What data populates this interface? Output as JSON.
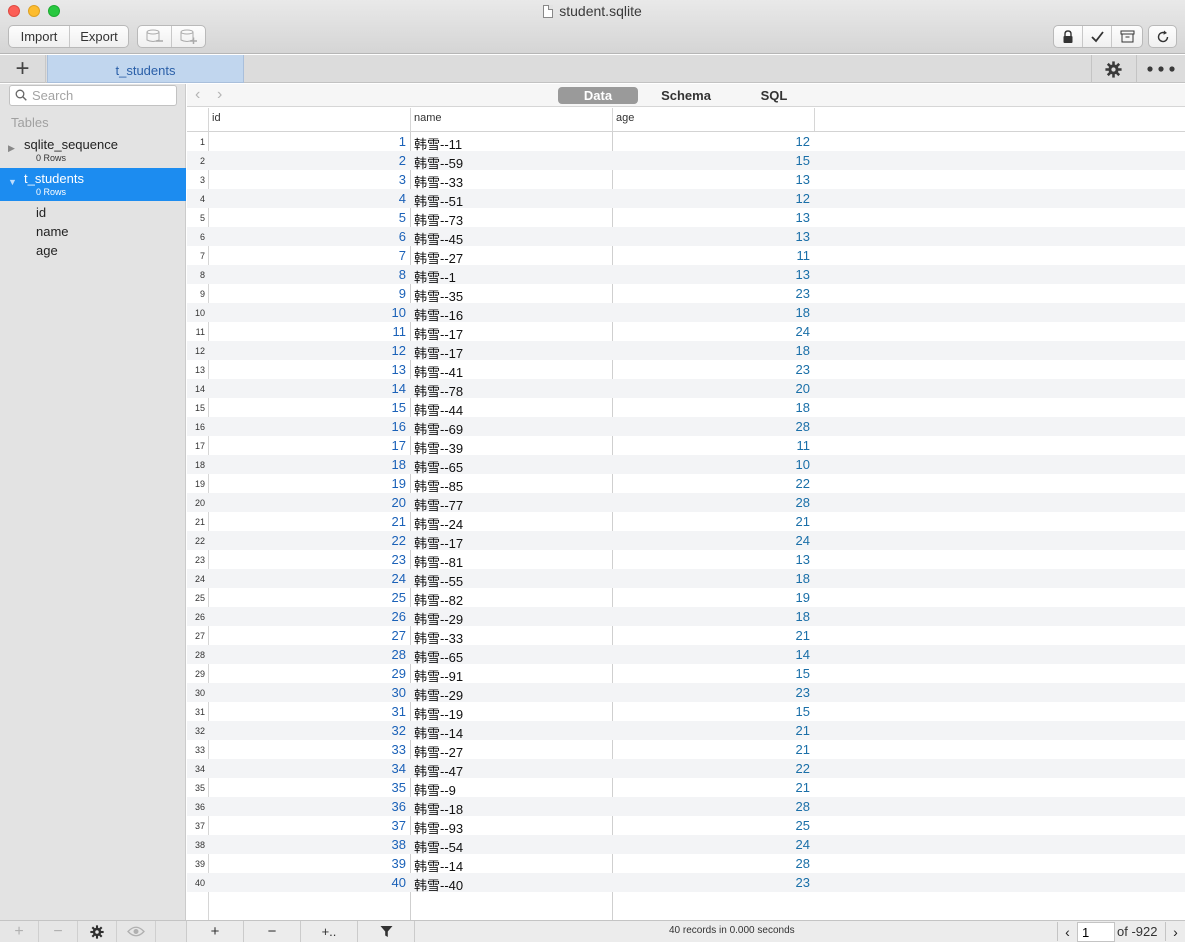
{
  "window": {
    "title": "student.sqlite"
  },
  "toolbar": {
    "import_label": "Import",
    "export_label": "Export",
    "db_remove_icon": "database-remove-icon",
    "db_add_icon": "database-add-icon",
    "lock_icon": "lock-icon",
    "check_icon": "checkmark-icon",
    "archive_icon": "archive-icon",
    "refresh_icon": "refresh-icon"
  },
  "tabs": {
    "add_label": "+",
    "active_tab": "t_students"
  },
  "sidebar": {
    "search_placeholder": "Search",
    "tables_header": "Tables",
    "tables": [
      {
        "name": "sqlite_sequence",
        "rows": "0 Rows",
        "expanded": false,
        "selected": false
      },
      {
        "name": "t_students",
        "rows": "0 Rows",
        "expanded": true,
        "selected": true
      }
    ],
    "columns": [
      "id",
      "name",
      "age"
    ]
  },
  "view_tabs": [
    "Data",
    "Schema",
    "SQL"
  ],
  "active_view": "Data",
  "grid": {
    "headers": [
      "id",
      "name",
      "age"
    ],
    "rows": [
      [
        1,
        "韩雪--11",
        12
      ],
      [
        2,
        "韩雪--59",
        15
      ],
      [
        3,
        "韩雪--33",
        13
      ],
      [
        4,
        "韩雪--51",
        12
      ],
      [
        5,
        "韩雪--73",
        13
      ],
      [
        6,
        "韩雪--45",
        13
      ],
      [
        7,
        "韩雪--27",
        11
      ],
      [
        8,
        "韩雪--1",
        13
      ],
      [
        9,
        "韩雪--35",
        23
      ],
      [
        10,
        "韩雪--16",
        18
      ],
      [
        11,
        "韩雪--17",
        24
      ],
      [
        12,
        "韩雪--17",
        18
      ],
      [
        13,
        "韩雪--41",
        23
      ],
      [
        14,
        "韩雪--78",
        20
      ],
      [
        15,
        "韩雪--44",
        18
      ],
      [
        16,
        "韩雪--69",
        28
      ],
      [
        17,
        "韩雪--39",
        11
      ],
      [
        18,
        "韩雪--65",
        10
      ],
      [
        19,
        "韩雪--85",
        22
      ],
      [
        20,
        "韩雪--77",
        28
      ],
      [
        21,
        "韩雪--24",
        21
      ],
      [
        22,
        "韩雪--17",
        24
      ],
      [
        23,
        "韩雪--81",
        13
      ],
      [
        24,
        "韩雪--55",
        18
      ],
      [
        25,
        "韩雪--82",
        19
      ],
      [
        26,
        "韩雪--29",
        18
      ],
      [
        27,
        "韩雪--33",
        21
      ],
      [
        28,
        "韩雪--65",
        14
      ],
      [
        29,
        "韩雪--91",
        15
      ],
      [
        30,
        "韩雪--29",
        23
      ],
      [
        31,
        "韩雪--19",
        15
      ],
      [
        32,
        "韩雪--14",
        21
      ],
      [
        33,
        "韩雪--27",
        21
      ],
      [
        34,
        "韩雪--47",
        22
      ],
      [
        35,
        "韩雪--9",
        21
      ],
      [
        36,
        "韩雪--18",
        28
      ],
      [
        37,
        "韩雪--93",
        25
      ],
      [
        38,
        "韩雪--54",
        24
      ],
      [
        39,
        "韩雪--14",
        28
      ],
      [
        40,
        "韩雪--40",
        23
      ]
    ]
  },
  "status": {
    "records_text": "40 records in 0.000 seconds",
    "page_value": "1",
    "page_of": "of -922",
    "add_row": "+",
    "remove_row": "−",
    "add_more": "+.."
  },
  "colors": {
    "selection": "#1c8cf0",
    "id_text": "#1a61b8",
    "age_text": "#1a6fa8",
    "active_tab": "#c1d6ee"
  }
}
